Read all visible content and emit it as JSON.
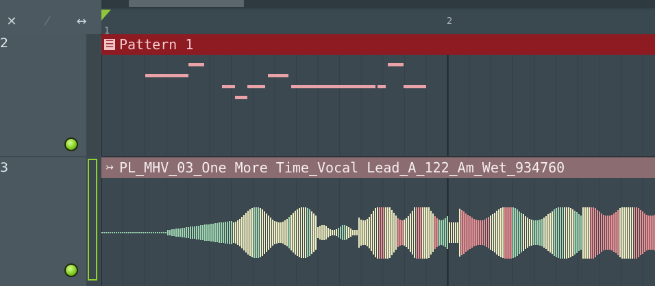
{
  "toolbar": {
    "icons": [
      "delete-icon",
      "slide-icon",
      "stretch-icon"
    ]
  },
  "ruler": {
    "labels": [
      "1",
      "2"
    ]
  },
  "tracks": [
    {
      "number": "2",
      "clip": {
        "kind": "pattern",
        "name": "Pattern 1",
        "header_color": "#8e1a22",
        "text_color": "#f3c9cb",
        "notes": [
          {
            "start": 0.0,
            "len": 0.17,
            "pitch": 4
          },
          {
            "start": 0.17,
            "len": 0.06,
            "pitch": 6
          },
          {
            "start": 0.3,
            "len": 0.05,
            "pitch": 2
          },
          {
            "start": 0.35,
            "len": 0.05,
            "pitch": 0
          },
          {
            "start": 0.4,
            "len": 0.02,
            "pitch": 2
          },
          {
            "start": 0.42,
            "len": 0.05,
            "pitch": 2
          },
          {
            "start": 0.48,
            "len": 0.08,
            "pitch": 4
          },
          {
            "start": 0.57,
            "len": 0.09,
            "pitch": 2
          },
          {
            "start": 0.66,
            "len": 0.14,
            "pitch": 2
          },
          {
            "start": 0.8,
            "len": 0.1,
            "pitch": 2
          },
          {
            "start": 0.91,
            "len": 0.03,
            "pitch": 2
          },
          {
            "start": 0.95,
            "len": 0.06,
            "pitch": 6
          },
          {
            "start": 1.01,
            "len": 0.09,
            "pitch": 2
          }
        ]
      }
    },
    {
      "number": "3",
      "clip": {
        "kind": "audio",
        "name": "PL_MHV_03_One More Time_Vocal Lead_A_122_Am_Wet_934760",
        "header_color": "#8b6c70",
        "text_color": "#f6ecee"
      }
    }
  ],
  "colors": {
    "led_on": "#8fd130",
    "wave_green": "#9fd6b2",
    "wave_cream": "#f2f0c2",
    "wave_red": "#ef8f94"
  }
}
